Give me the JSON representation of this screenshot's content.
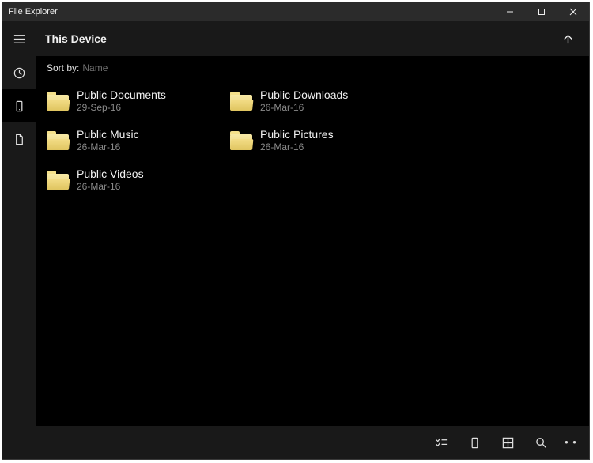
{
  "window": {
    "title": "File Explorer"
  },
  "header": {
    "location": "This Device"
  },
  "sort": {
    "label": "Sort by:",
    "value": "Name"
  },
  "folders": [
    {
      "name": "Public Documents",
      "date": "29-Sep-16"
    },
    {
      "name": "Public Downloads",
      "date": "26-Mar-16"
    },
    {
      "name": "Public Music",
      "date": "26-Mar-16"
    },
    {
      "name": "Public Pictures",
      "date": "26-Mar-16"
    },
    {
      "name": "Public Videos",
      "date": "26-Mar-16"
    }
  ],
  "sidebar": {
    "items": [
      {
        "id": "hamburger-icon"
      },
      {
        "id": "recent-icon"
      },
      {
        "id": "this-device-icon",
        "active": true
      },
      {
        "id": "document-icon"
      }
    ]
  }
}
